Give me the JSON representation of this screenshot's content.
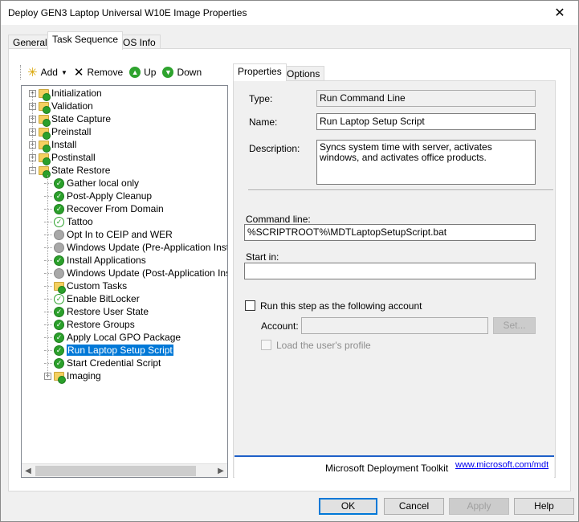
{
  "window": {
    "title": "Deploy GEN3 Laptop Universal W10E Image Properties",
    "close_glyph": "✕"
  },
  "tabs": [
    {
      "label": "General"
    },
    {
      "label": "Task Sequence"
    },
    {
      "label": "OS Info"
    }
  ],
  "toolbar": {
    "add_label": "Add",
    "remove_label": "Remove",
    "up_label": "Up",
    "down_label": "Down"
  },
  "tree": [
    {
      "label": "Initialization",
      "kind": "group",
      "depth": 0,
      "expander": "+"
    },
    {
      "label": "Validation",
      "kind": "group",
      "depth": 0,
      "expander": "+"
    },
    {
      "label": "State Capture",
      "kind": "group",
      "depth": 0,
      "expander": "+"
    },
    {
      "label": "Preinstall",
      "kind": "group",
      "depth": 0,
      "expander": "+"
    },
    {
      "label": "Install",
      "kind": "group",
      "depth": 0,
      "expander": "+"
    },
    {
      "label": "Postinstall",
      "kind": "group",
      "depth": 0,
      "expander": "+"
    },
    {
      "label": "State Restore",
      "kind": "group",
      "depth": 0,
      "expander": "−"
    },
    {
      "label": "Gather local only",
      "kind": "ok",
      "depth": 1
    },
    {
      "label": "Post-Apply Cleanup",
      "kind": "ok",
      "depth": 1
    },
    {
      "label": "Recover From Domain",
      "kind": "ok",
      "depth": 1
    },
    {
      "label": "Tattoo",
      "kind": "ok-hollow",
      "depth": 1
    },
    {
      "label": "Opt In to CEIP and WER",
      "kind": "off",
      "depth": 1
    },
    {
      "label": "Windows Update (Pre-Application Installa",
      "kind": "off",
      "depth": 1
    },
    {
      "label": "Install Applications",
      "kind": "ok",
      "depth": 1
    },
    {
      "label": "Windows Update (Post-Application Install",
      "kind": "off",
      "depth": 1
    },
    {
      "label": "Custom Tasks",
      "kind": "folder",
      "depth": 1
    },
    {
      "label": "Enable BitLocker",
      "kind": "ok-hollow",
      "depth": 1
    },
    {
      "label": "Restore User State",
      "kind": "ok",
      "depth": 1
    },
    {
      "label": "Restore Groups",
      "kind": "ok",
      "depth": 1
    },
    {
      "label": "Apply Local GPO Package",
      "kind": "ok",
      "depth": 1
    },
    {
      "label": "Run Laptop Setup Script",
      "kind": "ok",
      "depth": 1,
      "selected": true
    },
    {
      "label": "Start Credential Script",
      "kind": "ok",
      "depth": 1
    },
    {
      "label": "Imaging",
      "kind": "group",
      "depth": 1,
      "expander": "+"
    }
  ],
  "props_tabs": [
    {
      "label": "Properties"
    },
    {
      "label": "Options"
    }
  ],
  "props": {
    "type_label": "Type:",
    "type_value": "Run Command Line",
    "name_label": "Name:",
    "name_value": "Run Laptop Setup Script",
    "desc_label": "Description:",
    "desc_value": "Syncs system time with server, activates windows, and activates office products.",
    "cmd_label": "Command line:",
    "cmd_value": "%SCRIPTROOT%\\MDTLaptopSetupScript.bat",
    "startin_label": "Start in:",
    "startin_value": "",
    "runas_label": "Run this step as the following account",
    "account_label": "Account:",
    "account_value": "",
    "set_label": "Set...",
    "load_profile_label": "Load the user's profile",
    "footer_text": "Microsoft Deployment Toolkit",
    "footer_link": "www.microsoft.com/mdt"
  },
  "buttons": {
    "ok": "OK",
    "cancel": "Cancel",
    "apply": "Apply",
    "help": "Help"
  }
}
